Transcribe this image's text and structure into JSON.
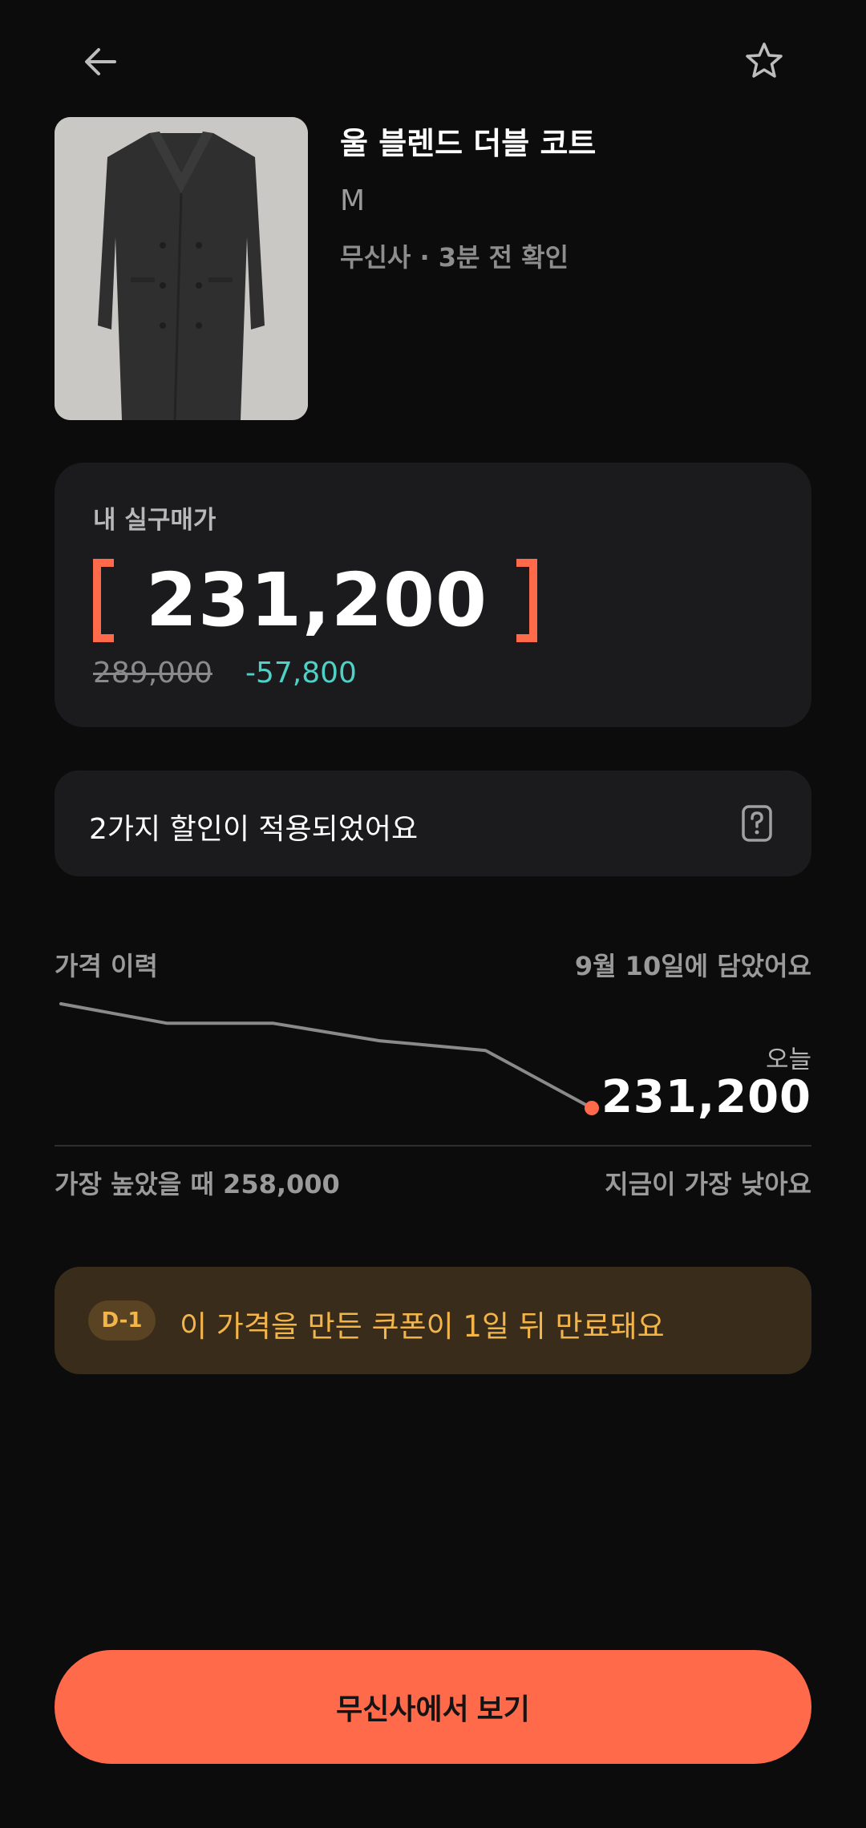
{
  "product": {
    "title": "울 블렌드 더블 코트",
    "size": "M",
    "meta": "무신사 · 3분 전 확인",
    "image_icon": "coat-image"
  },
  "price_card": {
    "label": "내 실구매가",
    "price": "231,200",
    "original_price": "289,000",
    "discount": "-57,800",
    "accent_color": "#ff6b4a",
    "discount_color": "#4fd1c5"
  },
  "discount_info": {
    "text": "2가지 할인이 적용되었어요",
    "icon": "help-icon"
  },
  "history": {
    "title": "가격 이력",
    "date_text": "9월 10일에 담았어요",
    "today_label": "오늘",
    "today_price": "231,200",
    "high_text": "가장 높았을 때 258,000",
    "lowest_text": "지금이 가장 낮아요"
  },
  "chart_data": {
    "type": "line",
    "title": "",
    "xlabel": "",
    "ylabel": "",
    "series": [
      {
        "values": [
          258000,
          253000,
          253000,
          248500,
          246000,
          231200
        ]
      }
    ],
    "ylim": [
      231200,
      258000
    ],
    "grid": false
  },
  "coupon": {
    "badge": "D-1",
    "text": "이 가격을 만든 쿠폰이 1일 뒤 만료돼요",
    "color": "#f3b54a"
  },
  "cta": {
    "label": "무신사에서 보기",
    "color": "#ff6a4a"
  },
  "nav": {
    "back_icon": "arrow-left-icon",
    "favorite_icon": "star-icon"
  }
}
